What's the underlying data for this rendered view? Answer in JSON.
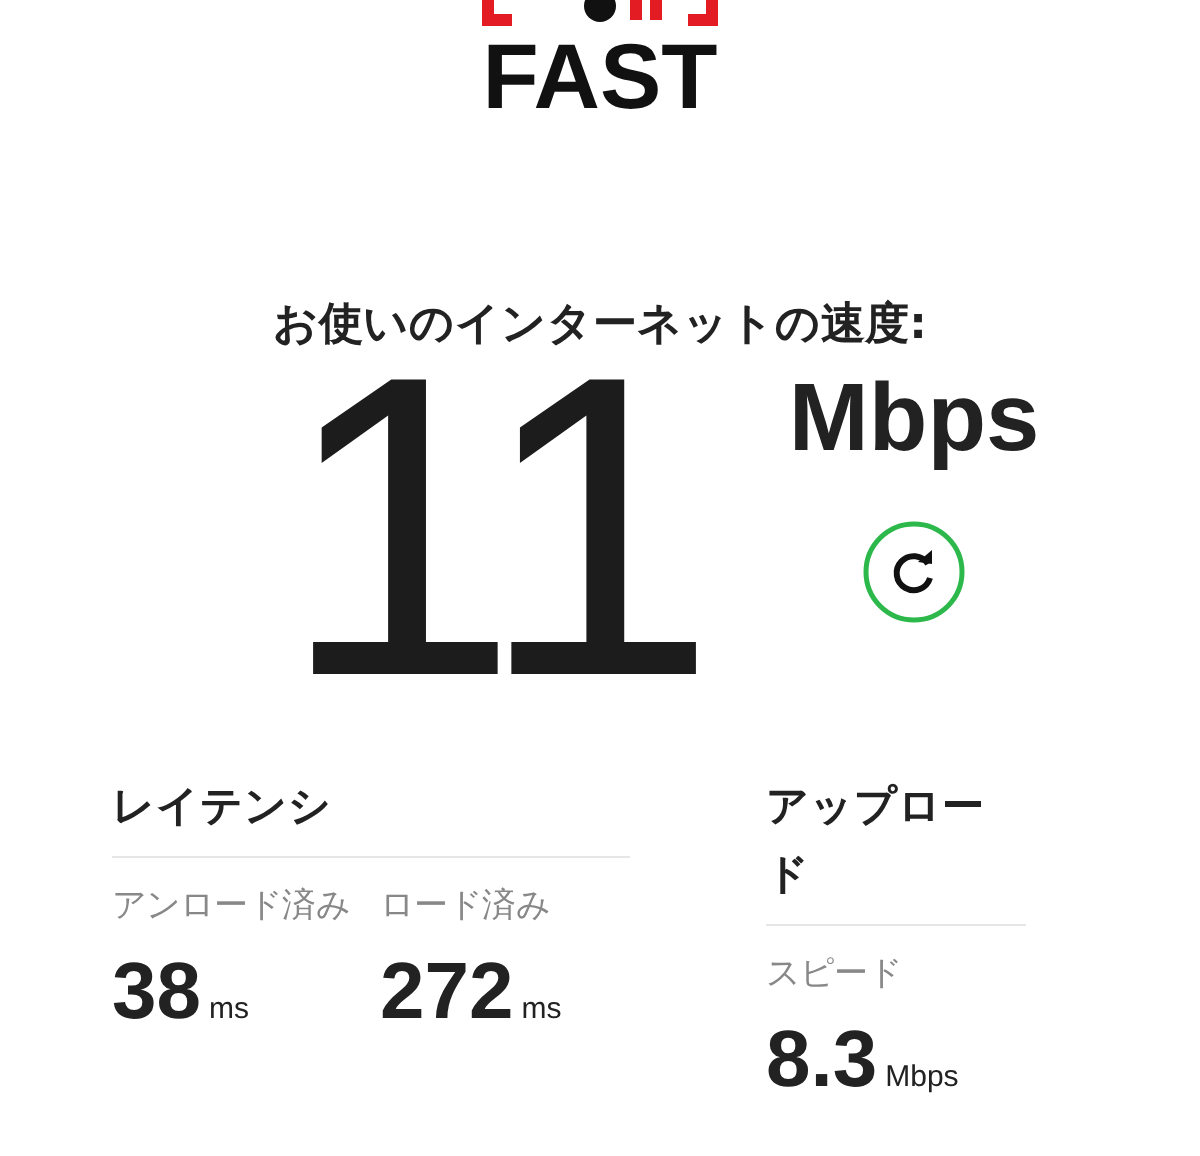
{
  "logo": {
    "text": "FAST"
  },
  "speed": {
    "heading": "お使いのインターネットの速度:",
    "value": "11",
    "unit": "Mbps"
  },
  "latency": {
    "title": "レイテンシ",
    "metrics": [
      {
        "label": "アンロード済み",
        "value": "38",
        "unit": "ms"
      },
      {
        "label": "ロード済み",
        "value": "272",
        "unit": "ms"
      }
    ]
  },
  "upload": {
    "title": "アップロード",
    "metrics": [
      {
        "label": "スピード",
        "value": "8.3",
        "unit": "Mbps"
      }
    ]
  }
}
